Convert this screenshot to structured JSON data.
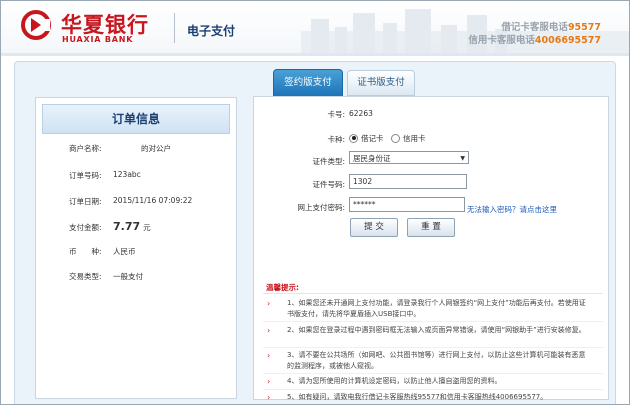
{
  "header": {
    "bank_name_cn": "华夏银行",
    "bank_name_en": "HUAXIA BANK",
    "section_title": "电子支付",
    "hotline_debit_label": "借记卡客服电话",
    "hotline_debit_number": "95577",
    "hotline_credit_label": "信用卡客服电话",
    "hotline_credit_number": "4006695577"
  },
  "tabs": [
    {
      "label": "签约版支付",
      "active": true
    },
    {
      "label": "证书版支付",
      "active": false
    }
  ],
  "order": {
    "title": "订单信息",
    "rows": [
      {
        "label": "商户名称:",
        "value": "的对公户"
      },
      {
        "label": "订单号码:",
        "value": "123abc"
      },
      {
        "label": "订单日期:",
        "value": "2015/11/16 07:09:22"
      },
      {
        "label": "支付金额:",
        "value": "7.77",
        "unit": "元"
      },
      {
        "label": "币　　种:",
        "value": "人民币"
      },
      {
        "label": "交易类型:",
        "value": "一般支付"
      }
    ]
  },
  "form": {
    "card_no_label": "卡号:",
    "card_no_value": "62263",
    "card_type_label": "卡种:",
    "card_type_options": [
      "借记卡",
      "信用卡"
    ],
    "card_type_selected": "借记卡",
    "id_type_label": "证件类型:",
    "id_type_value": "居民身份证",
    "id_number_label": "证件号码:",
    "id_number_value": "1302",
    "password_label": "网上支付密码:",
    "password_value": "******",
    "forgot_link": "无法输入密码？请点击这里",
    "submit_label": "提 交",
    "reset_label": "重 置"
  },
  "tips": {
    "title": "温馨提示:",
    "items": [
      "1、如果您还未开通网上支付功能，请登录我行个人网银签约“网上支付”功能后再支付。若使用证书版支付，请先将华夏盾插入USB接口中。",
      "2、如果您在登录过程中遇到密码框无法输入或页面异常错误，请使用“网银助手”进行安装修复。",
      "3、请不要在公共场所（如网吧、公共图书馆等）进行网上支付，以防止这些计算机可能装有恶意的监测程序，或被他人窥视。",
      "4、请为您所使用的计算机设定密码，以防止他人擅自盗用您的资料。",
      "5、如有疑问，请致电我行借记卡客服热线95577和信用卡客服热线4006695577。"
    ],
    "helper_link": "网银助手"
  },
  "colors": {
    "brand_red": "#c8161e",
    "hotline_orange": "#e67a15",
    "tab_active": "#1d74b8",
    "link_blue": "#1a5bb8"
  }
}
